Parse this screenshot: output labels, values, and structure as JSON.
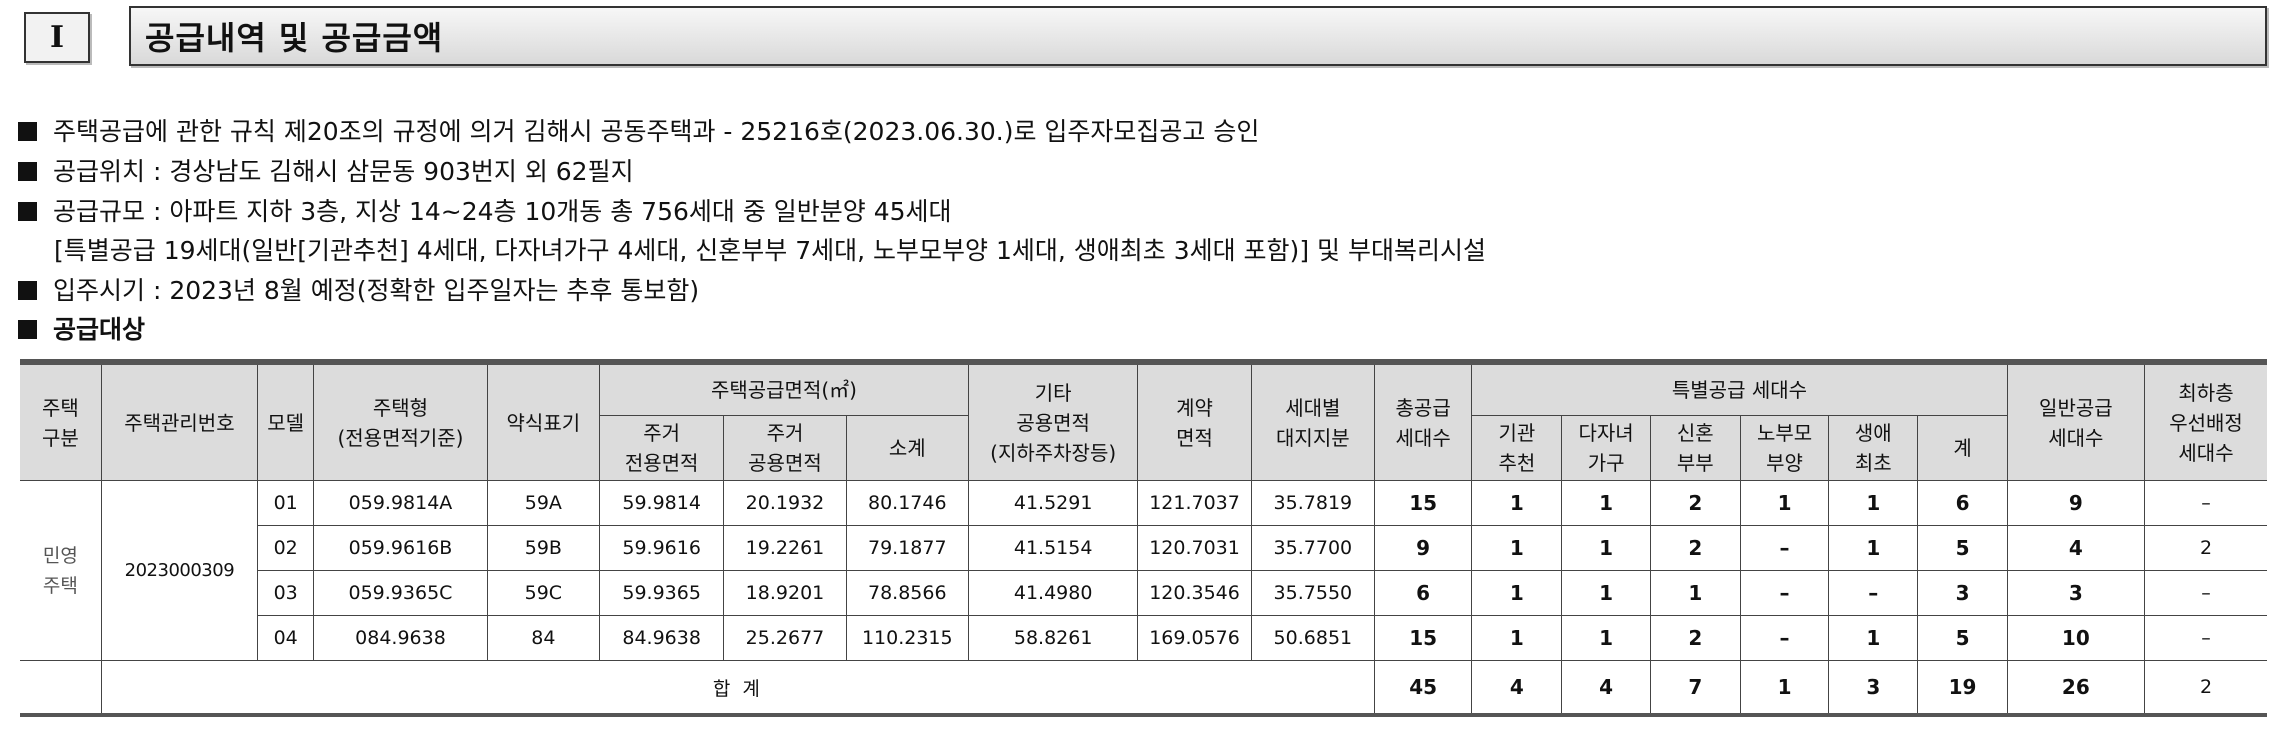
{
  "section": {
    "number": "I",
    "title": "공급내역 및 공급금액"
  },
  "info_lines": [
    "주택공급에 관한 규칙 제20조의 규정에 의거 김해시 공동주택과 - 25216호(2023.06.30.)로 입주자모집공고 승인",
    "공급위치 : 경상남도 김해시 삼문동 903번지 외 62필지",
    "공급규모 : 아파트 지하 3층, 지상 14~24층 10개동 총 756세대 중 일반분양 45세대",
    "[특별공급 19세대(일반[기관추천] 4세대, 다자녀가구 4세대, 신혼부부 7세대, 노부모부양 1세대, 생애최초 3세대 포함)] 및 부대복리시설",
    "입주시기 : 2023년 8월 예정(정확한 입주일자는 추후 통보함)",
    "공급대상"
  ],
  "table": {
    "headers": {
      "housing_type": "주택\n구분",
      "management_no": "주택관리번호",
      "model": "모델",
      "unit_type": "주택형\n(전용면적기준)",
      "short_label": "약식표기",
      "supply_area_group": "주택공급면적(㎡)",
      "private_area": "주거\n전용면적",
      "common_area": "주거\n공용면적",
      "subtotal": "소계",
      "other_common": "기타\n공용면적\n(지하주차장등)",
      "contract_area": "계약\n면적",
      "land_share": "세대별\n대지지분",
      "total_supply": "총공급\n세대수",
      "special_group": "특별공급 세대수",
      "institution": "기관\n추천",
      "multi_child": "다자녀\n가구",
      "newlywed": "신혼\n부부",
      "elderly_parent": "노부모\n부양",
      "first_time": "생애\n최초",
      "special_sum": "계",
      "general_supply": "일반공급\n세대수",
      "lowest_floor": "최하층\n우선배정\n세대수"
    },
    "housing_type_value": "민영\n주택",
    "management_no_value": "2023000309",
    "rows": [
      {
        "model": "01",
        "unit_type": "059.9814A",
        "short": "59A",
        "private": "59.9814",
        "common": "20.1932",
        "subtotal": "80.1746",
        "other": "41.5291",
        "contract": "121.7037",
        "land": "35.7819",
        "total": "15",
        "inst": "1",
        "multi": "1",
        "newly": "2",
        "elder": "1",
        "first": "1",
        "sum": "6",
        "general": "9",
        "lowest": "–"
      },
      {
        "model": "02",
        "unit_type": "059.9616B",
        "short": "59B",
        "private": "59.9616",
        "common": "19.2261",
        "subtotal": "79.1877",
        "other": "41.5154",
        "contract": "120.7031",
        "land": "35.7700",
        "total": "9",
        "inst": "1",
        "multi": "1",
        "newly": "2",
        "elder": "–",
        "first": "1",
        "sum": "5",
        "general": "4",
        "lowest": "2"
      },
      {
        "model": "03",
        "unit_type": "059.9365C",
        "short": "59C",
        "private": "59.9365",
        "common": "18.9201",
        "subtotal": "78.8566",
        "other": "41.4980",
        "contract": "120.3546",
        "land": "35.7550",
        "total": "6",
        "inst": "1",
        "multi": "1",
        "newly": "1",
        "elder": "–",
        "first": "–",
        "sum": "3",
        "general": "3",
        "lowest": "–"
      },
      {
        "model": "04",
        "unit_type": "084.9638",
        "short": "84",
        "private": "84.9638",
        "common": "25.2677",
        "subtotal": "110.2315",
        "other": "58.8261",
        "contract": "169.0576",
        "land": "50.6851",
        "total": "15",
        "inst": "1",
        "multi": "1",
        "newly": "2",
        "elder": "–",
        "first": "1",
        "sum": "5",
        "general": "10",
        "lowest": "–"
      }
    ],
    "total_row": {
      "label": "합 계",
      "total": "45",
      "inst": "4",
      "multi": "4",
      "newly": "7",
      "elder": "1",
      "first": "3",
      "sum": "19",
      "general": "26",
      "lowest": "2"
    }
  }
}
